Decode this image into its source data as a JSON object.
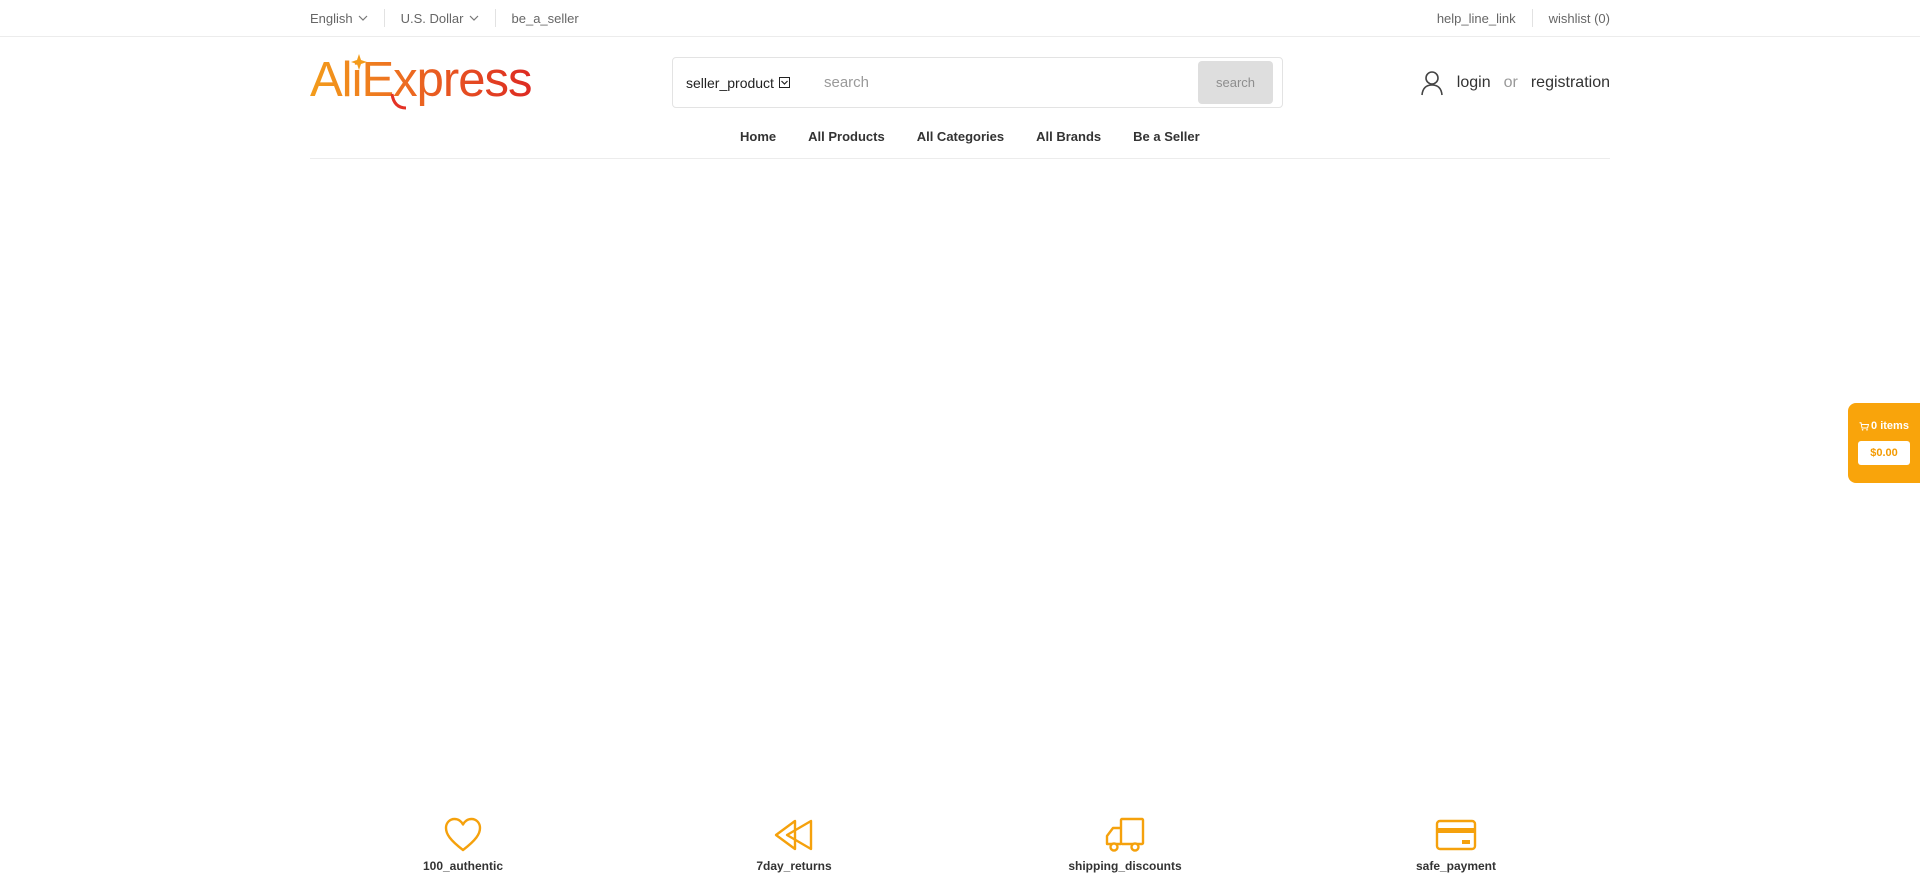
{
  "topbar": {
    "language": "English",
    "currency": "U.S. Dollar",
    "be_a_seller": "be_a_seller",
    "help_line": "help_line_link",
    "wishlist": "wishlist (0)"
  },
  "logo": {
    "ali": "Ali",
    "express": "Express"
  },
  "search": {
    "type_label": "seller_product",
    "placeholder": "search",
    "button_label": "search"
  },
  "auth": {
    "login": "login",
    "or": "or",
    "registration": "registration"
  },
  "nav": {
    "items": [
      "Home",
      "All Products",
      "All Categories",
      "All Brands",
      "Be a Seller"
    ]
  },
  "cart": {
    "items_label": "0 items",
    "total": "$0.00"
  },
  "features": [
    {
      "label": "100_authentic",
      "icon": "heart-icon"
    },
    {
      "label": "7day_returns",
      "icon": "rewind-icon"
    },
    {
      "label": "shipping_discounts",
      "icon": "truck-icon"
    },
    {
      "label": "safe_payment",
      "icon": "credit-card-icon"
    }
  ],
  "colors": {
    "accent": "#f9a40b",
    "logo_orange": "#f39c1b",
    "logo_red": "#e43225"
  }
}
